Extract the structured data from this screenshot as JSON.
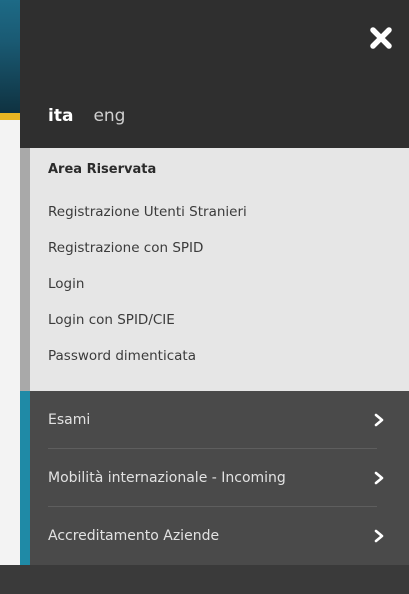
{
  "languages": [
    {
      "label": "ita",
      "active": true
    },
    {
      "label": "eng",
      "active": false
    }
  ],
  "area": {
    "title": "Area Riservata",
    "links": [
      "Registrazione Utenti Stranieri",
      "Registrazione con SPID",
      "Login",
      "Login con SPID/CIE",
      "Password dimenticata"
    ]
  },
  "menu": {
    "items": [
      {
        "label": "Esami"
      },
      {
        "label": "Mobilità internazionale - Incoming"
      },
      {
        "label": "Accreditamento Aziende"
      }
    ]
  },
  "icons": {
    "close": "close-icon",
    "chevron": "chevron-right-icon"
  },
  "colors": {
    "drawer_bg": "#2f2f2f",
    "area_bg": "#e6e6e6",
    "menu_bg": "#4a4a4a",
    "accent_teal": "#1f8aa6",
    "accent_yellow": "#e8b623"
  }
}
